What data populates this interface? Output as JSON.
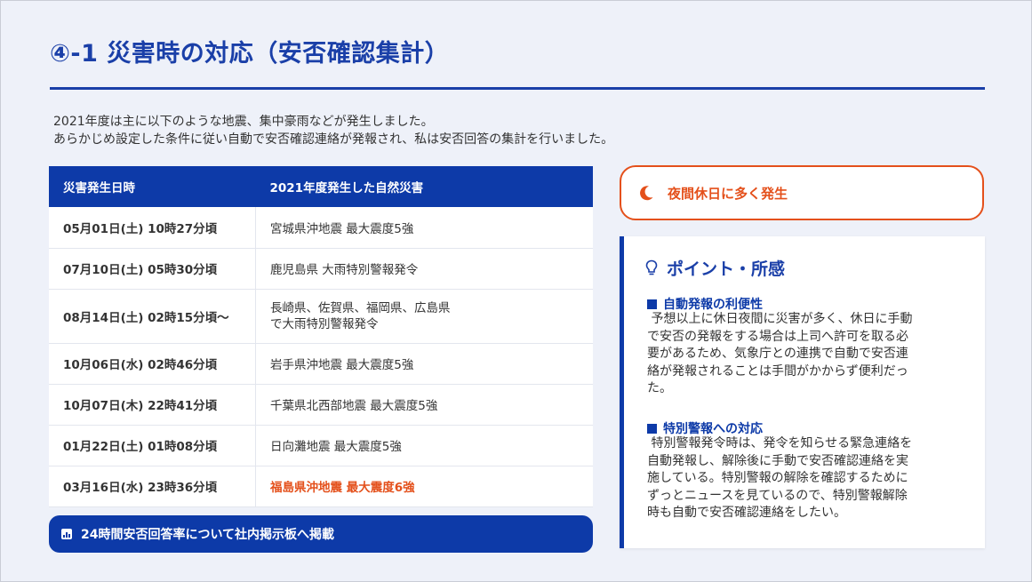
{
  "title": "④-1 災害時の対応（安否確認集計）",
  "intro": {
    "line1": "2021年度は主に以下のような地震、集中豪雨などが発生しました。",
    "line2": "あらかじめ設定した条件に従い自動で安否確認連絡が発報され、私は安否回答の集計を行いました。"
  },
  "table": {
    "headers": [
      "災害発生日時",
      "2021年度発生した自然災害"
    ],
    "rows": [
      {
        "date": "05月01日(土) 10時27分頃",
        "event": [
          "宮城県沖地震 最大震度5強"
        ]
      },
      {
        "date": "07月10日(土) 05時30分頃",
        "event": [
          "鹿児島県 大雨特別警報発令"
        ]
      },
      {
        "date": "08月14日(土) 02時15分頃〜",
        "event": [
          "長崎県、佐賀県、福岡県、広島県",
          "で大雨特別警報発令"
        ]
      },
      {
        "date": "10月06日(水) 02時46分頃",
        "event": [
          "岩手県沖地震 最大震度5強"
        ]
      },
      {
        "date": "10月07日(木) 22時41分頃",
        "event": [
          "千葉県北西部地震 最大震度5強"
        ]
      },
      {
        "date": "01月22日(土) 01時08分頃",
        "event": [
          "日向灘地震 最大震度5強"
        ]
      },
      {
        "date": "03月16日(水) 23時36分頃",
        "event": [
          "福島県沖地震 最大震度6強"
        ],
        "highlight": true
      }
    ]
  },
  "banner": {
    "icon": "bar-chart-icon",
    "text": "24時間安否回答率について社内掲示板へ掲載"
  },
  "alert": {
    "icon": "moon-icon",
    "text": "夜間休日に多く発生",
    "color": "#e4501b"
  },
  "points": {
    "icon": "lightbulb-icon",
    "title": "ポイント・所感",
    "sections": [
      {
        "title": "自動発報の利便性",
        "body": [
          " 予想以上に休日夜間に災害が多く、休日に手動",
          "で安否の発報をする場合は上司へ許可を取る必",
          "要があるため、気象庁との連携で自動で安否連",
          "絡が発報されることは手間がかからず便利だっ",
          "た。"
        ]
      },
      {
        "title": "特別警報への対応",
        "body": [
          " 特別警報発令時は、発令を知らせる緊急連絡を",
          "自動発報し、解除後に手動で安否確認連絡を実",
          "施している。特別警報の解除を確認するために",
          "ずっとニュースを見ているので、特別警報解除",
          "時も自動で安否確認連絡をしたい。"
        ]
      }
    ]
  },
  "colors": {
    "primary": "#0d3aa8",
    "accent": "#e4501b",
    "background": "#eef1f9"
  }
}
